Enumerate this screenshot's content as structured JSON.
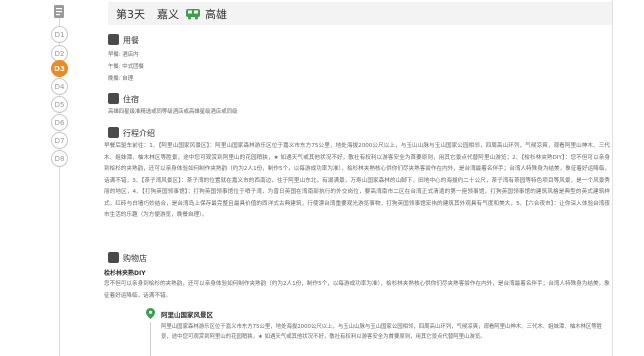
{
  "timeline": {
    "days": [
      {
        "label": "D1",
        "active": false
      },
      {
        "label": "D2",
        "active": false
      },
      {
        "label": "D3",
        "active": true
      },
      {
        "label": "D4",
        "active": false
      },
      {
        "label": "D5",
        "active": false
      },
      {
        "label": "D6",
        "active": false
      },
      {
        "label": "D7",
        "active": false
      },
      {
        "label": "D8",
        "active": false
      }
    ],
    "accent_color": "#ef8a1e"
  },
  "header": {
    "day": "第3天",
    "from_city": "嘉义",
    "transport_icon": "bus-icon",
    "to_city": "高雄"
  },
  "meals": {
    "title": "用餐",
    "breakfast": "早餐: 酒店内",
    "lunch": "午餐: 中式团餐",
    "dinner": "晚餐: 自理"
  },
  "hotel": {
    "title": "住宿",
    "text": "高雄四星级准精选或同等级酒店或高雄星级酒店或同级"
  },
  "itinerary": {
    "title": "行程介绍",
    "text": "早餐后驱车前往：1、【阿里山国家风景区】：阿里山国家森林游乐区位于嘉义市东方75公里，地处海拔2000公尺以上，与玉山山脉与玉山国家公园相邻，四周高山环列，气候凉爽，观看阿里山神木、三代木、姐妹潭、柚木林区等胜景，途中您可观赏到阿里山的花园稍狭，★ 如遇天气或其他状况不好，敬社有权利以游客安全为首要原则，用其它景点代替阿里山游览；2、【桧杉林夹熟DIY】：您不但可以亲身到桧杉的夹熟韵，还可以亲身体验如何制作夹熟韵（约为2人1份，制作5个，以每游成功率为准），桧杉林夹熟核心供你们尽夹熟客尝作在内外，是台湾最着名伴手；台湾人特殊身为结美，象征着好运降临，话满不错，3、【茶子湾风景区】：茶子湾的位置就在嘉义市的西南边，往于阿里山东北，有湖满景，万寿山国家森林的山脚下，田地中心的海拔约二十公尺，茶子湾有茶园等特色项目等风景，是一个风景秀丽的地区，4、【打狗英国领事馆】：打狗英国领事馆位于哨子湾，为曾日英国在湾南部执行的外交岗位，要高湾南市二区在台湾正式清遣的第一座领事馆，打狗英国领事馆的建筑风格是典型的英式建筑样式，红砖与白墙巧妙结合，是台湾岛上保存最完整且最具价值的西洋式古典建筑，行使漂台湾重要观光游览事物，打狗英国领事馆宏伟的建筑其外观具有气度和美大，5、【六合夜市】：让你深入体验台湾夜市生活的乐趣（为方便游览，晚餐自理）。"
  },
  "shopping": {
    "title": "购物店",
    "item_title": "桧杉林夹熟DIY",
    "item_text": "您不但可以亲身到桧杉的夹熟韵，还可以亲身体验如何制作夹熟韵（约为2人1份，制作5个，以每游成功率为准），桧杉林夹熟核心供你们尽夹熟客尝作在内外，是台湾最着名伴手；台湾人特殊身为结美，象征着好运降临，话满不错。"
  },
  "poi": {
    "title": "阿里山国家风景区",
    "text": "阿里山国家森林游乐区位于嘉义市东方75公里，地处海拔2000公尺以上，与玉山山脉与玉山国家公园相邻，四周高山环列，气候凉爽，观看阿里山神木、三代木、姐妹潭、柚木林区等胜景，途中您可观赏到阿里山的花园稍狭，★ 如遇天气或其他状况不好，敬社有权利以游客安全为首要原则，用其它景点代替阿里山游览。"
  }
}
